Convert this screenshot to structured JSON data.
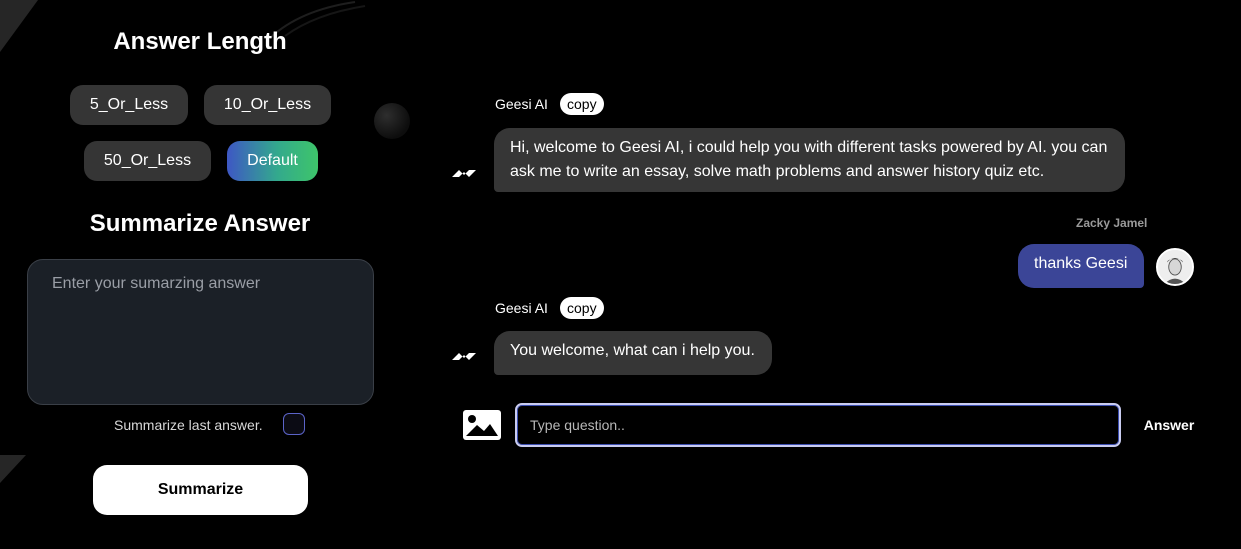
{
  "answer_length": {
    "title": "Answer Length",
    "options": [
      "5_Or_Less",
      "10_Or_Less",
      "50_Or_Less",
      "Default"
    ],
    "selected": "Default"
  },
  "summarize": {
    "title": "Summarize Answer",
    "placeholder": "Enter your sumarzing answer",
    "checkbox_label": "Summarize last answer.",
    "checkbox_checked": false,
    "button_label": "Summarize"
  },
  "chat": {
    "messages": [
      {
        "sender": "Geesi AI",
        "copy_label": "copy",
        "text_line1": "Hi, welcome to Geesi AI, i could help you with different tasks powered by AI. you can",
        "text_line2": "ask me to write an essay, solve math problems and answer history quiz etc."
      },
      {
        "sender": "Zacky Jamel",
        "text": "thanks Geesi"
      },
      {
        "sender": "Geesi AI",
        "copy_label": "copy",
        "text": "You welcome, what can i help you."
      }
    ]
  },
  "input": {
    "placeholder": "Type question..",
    "submit_label": "Answer"
  },
  "colors": {
    "background": "#000000",
    "bot_bubble": "#363636",
    "user_bubble": "#3b4597",
    "default_gradient_start": "#3e57c4",
    "default_gradient_end": "#3ec56a"
  }
}
